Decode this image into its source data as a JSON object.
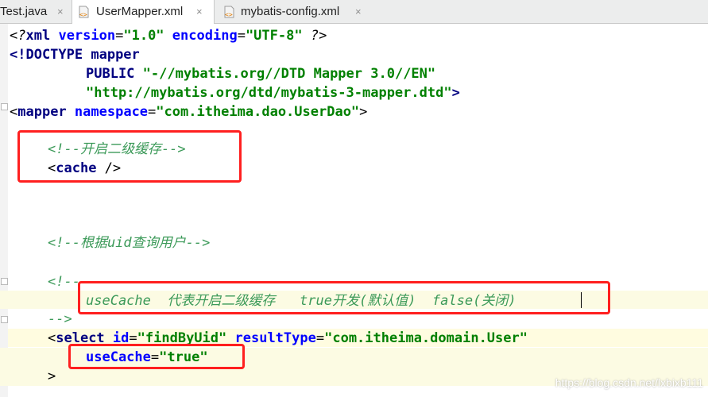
{
  "tabs": [
    {
      "label": "Test.java",
      "active": false,
      "icon": "java-file-icon"
    },
    {
      "label": "UserMapper.xml",
      "active": true,
      "icon": "xml-file-icon"
    },
    {
      "label": "mybatis-config.xml",
      "active": false,
      "icon": "xml-file-icon"
    }
  ],
  "close_glyph": "×",
  "code": {
    "l1": {
      "open": "<?",
      "name": "xml",
      "a1": "version",
      "v1": "\"1.0\"",
      "a2": "encoding",
      "v2": "\"UTF-8\"",
      "close": "?>"
    },
    "l2": {
      "open": "<!DOCTYPE ",
      "name": "mapper"
    },
    "l3": {
      "kw": "PUBLIC",
      "v": "\"-//mybatis.org//DTD Mapper 3.0//EN\""
    },
    "l4": {
      "v": "\"http://mybatis.org/dtd/mybatis-3-mapper.dtd\"",
      "close": ">"
    },
    "l5": {
      "open": "<",
      "name": "mapper",
      "a": "namespace",
      "v": "\"com.itheima.dao.UserDao\"",
      "close": ">"
    },
    "l6": {
      "comment": "<!--开启二级缓存-->"
    },
    "l7": {
      "open": "<",
      "name": "cache",
      "close": " />"
    },
    "l8": {
      "comment": "<!--根据uid查询用户-->"
    },
    "l9": {
      "comment": "<!--"
    },
    "l10": {
      "comment": "useCache  代表开启二级缓存   true开发(默认值)  false(关闭)"
    },
    "l11": {
      "comment": "-->"
    },
    "l12": {
      "open": "<",
      "name": "select",
      "a1": "id",
      "v1": "\"findByUid\"",
      "a2": "resultType",
      "v2": "\"com.itheima.domain.User\""
    },
    "l13": {
      "a": "useCache",
      "v": "\"true\""
    },
    "l14": {
      "close": ">"
    }
  },
  "watermark": "https://blog.csdn.net/lxbixb111",
  "colors": {
    "annotation": "#ff1f1f",
    "tag": "#000080",
    "attribute": "#0000ff",
    "value": "#008000",
    "comment": "#808080"
  }
}
